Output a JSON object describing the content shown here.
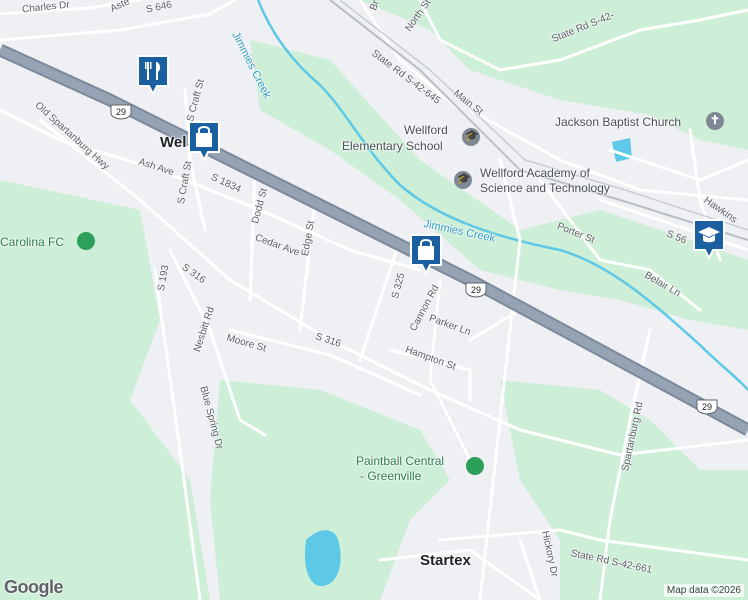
{
  "colors": {
    "background": "#eef0f3",
    "park": "#cdeed7",
    "highway": "#8c9aab",
    "water": "#5ec9e6",
    "pin": "#1a5fa0",
    "poi_green": "#2e9e5b",
    "poi_gray": "#7e8794"
  },
  "map": {
    "town_labels": {
      "wellford": "Wel",
      "startex": "Startex"
    },
    "road_labels": {
      "charles_dr": "Charles Dr",
      "aste": "Aste",
      "s646": "S 646",
      "north_st": "North St",
      "br": "Br",
      "state_rd_s42_top": "State Rd S-42-",
      "state_rd_s42_645": "State Rd S-42-645",
      "main_st": "Main St",
      "old_spartanburg_hwy": "Old Spartanburg Hwy",
      "s_craft_st": "S Craft St",
      "s_craft_st_2": "S Craft St",
      "ash_ave": "Ash Ave",
      "s1834": "S 1834",
      "dodd_st": "Dodd St",
      "edge_st": "Edge St",
      "cedar_ave": "Cedar Ave",
      "s316": "S 316",
      "s316_2": "S 316",
      "s193": "S 193",
      "nesbitt_rd": "Nesbitt Rd",
      "moore_st": "Moore St",
      "s325": "S 325",
      "cannon_rd": "Cannon Rd",
      "parker_ln": "Parker Ln",
      "hampton_st": "Hampton St",
      "blue_spring_dr": "Blue Spring Dr",
      "porter_st": "Porter St",
      "belair_ln": "Belair Ln",
      "hawkins": "Hawkins",
      "s56": "S 56",
      "spartanburg_rd": "Spartanburg Rd",
      "state_rd_s42_661": "State Rd S-42-661",
      "hickory_dr": "Hickory Dr"
    },
    "water_labels": {
      "jimmies_creek_top": "Jimmies Creek",
      "jimmies_creek_mid": "Jimmies Creek"
    },
    "pois": {
      "wellford_elementary_line1": "Wellford",
      "wellford_elementary_line2": "Elementary School",
      "wellford_academy_line1": "Wellford Academy of",
      "wellford_academy_line2": "Science and Technology",
      "jackson_baptist": "Jackson Baptist Church",
      "carolina_fc": "Carolina FC",
      "paintball_line1": "Paintball Central",
      "paintball_line2": "- Greenville"
    },
    "shields": [
      "29",
      "29",
      "29"
    ],
    "markers": [
      {
        "type": "restaurant",
        "icon": "fork-knife-icon"
      },
      {
        "type": "shopping",
        "icon": "shopping-bag-icon"
      },
      {
        "type": "shopping",
        "icon": "shopping-bag-icon"
      },
      {
        "type": "school",
        "icon": "graduation-cap-icon"
      }
    ]
  },
  "footer": {
    "attribution": "Map data ©2026",
    "logo": "Google"
  }
}
